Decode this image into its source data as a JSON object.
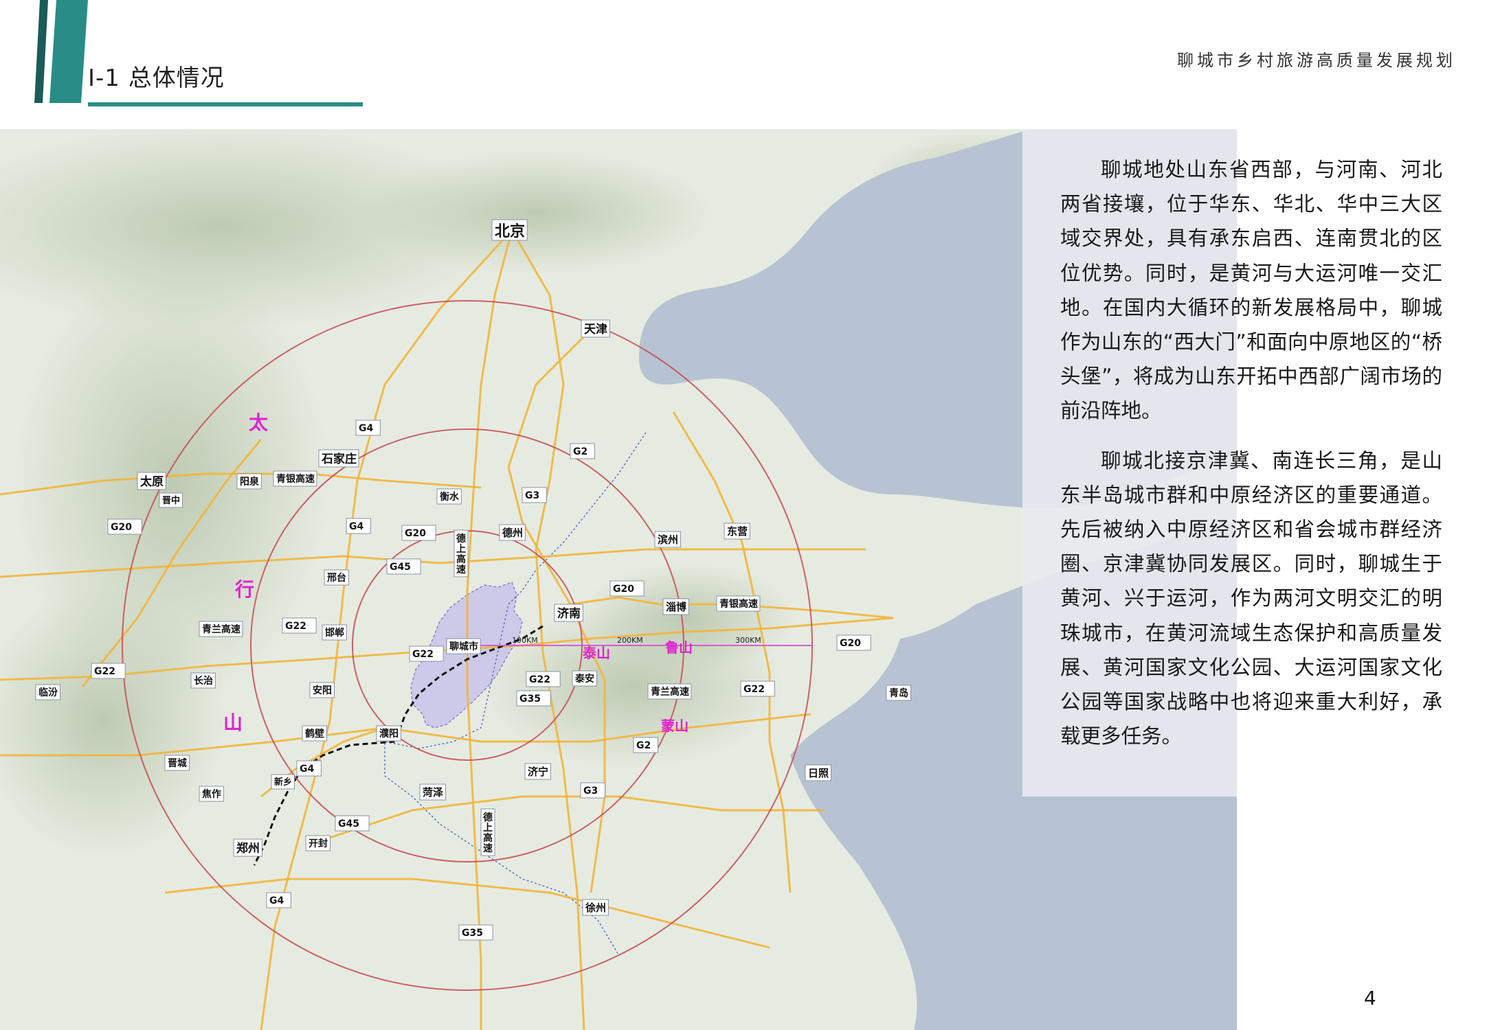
{
  "header": {
    "section_title": "Ⅰ-1 总体情况",
    "doc_title": "聊城市乡村旅游高质量发展规划"
  },
  "colors": {
    "accent_teal": "#2a8c86",
    "accent_dark": "#1b5c59",
    "ring": "#c7484e",
    "highway": "#f2b53a",
    "city_region": "#c8c3ea",
    "mountain_label": "#e024d0"
  },
  "map": {
    "cities": {
      "beijing": "北京",
      "tianjin": "天津",
      "shijiazhuang": "石家庄",
      "taiyuan": "太原",
      "yangquan": "阳泉",
      "jinzhong": "晋中",
      "hengshui": "衡水",
      "dezhou": "德州",
      "binzhou": "滨州",
      "dongying": "东营",
      "xingtai": "邢台",
      "jinan": "济南",
      "zibo": "淄博",
      "handan": "邯郸",
      "changzhi": "长治",
      "linfen": "临汾",
      "anyang": "安阳",
      "liaocheng": "聊城市",
      "taian": "泰安",
      "hebi": "鹤壁",
      "puyang": "濮阳",
      "jincheng": "晋城",
      "jiaozuo": "焦作",
      "xinxiang": "新乡",
      "jining": "济宁",
      "heze": "菏泽",
      "rizhao": "日照",
      "qingdao": "青岛",
      "zhengzhou": "郑州",
      "kaifeng": "开封",
      "xuzhou": "徐州"
    },
    "highways": {
      "g4": "G4",
      "g2": "G2",
      "g3": "G3",
      "g20": "G20",
      "g22": "G22",
      "g45": "G45",
      "g35": "G35",
      "qingyin": "青银高速",
      "qinglan": "青兰高速",
      "deshang_vertical": "德上高速"
    },
    "mountains": {
      "taihang": [
        "太",
        "行",
        "山"
      ],
      "taishan": "泰山",
      "lushan": "鲁山",
      "mengshan": "蒙山"
    },
    "distances": {
      "d100": "100KM",
      "d200": "200KM",
      "d300": "300KM"
    }
  },
  "body": {
    "paragraph_1": "聊城地处山东省西部，与河南、河北两省接壤，位于华东、华北、华中三大区域交界处，具有承东启西、连南贯北的区位优势。同时，是黄河与大运河唯一交汇地。在国内大循环的新发展格局中，聊城作为山东的“西大门”和面向中原地区的“桥头堡”，将成为山东开拓中西部广阔市场的前沿阵地。",
    "paragraph_2": "聊城北接京津冀、南连长三角，是山东半岛城市群和中原经济区的重要通道。先后被纳入中原经济区和省会城市群经济圈、京津冀协同发展区。同时，聊城生于黄河、兴于运河，作为两河文明交汇的明珠城市，在黄河流域生态保护和高质量发展、黄河国家文化公园、大运河国家文化公园等国家战略中也将迎来重大利好，承载更多任务。"
  },
  "footer": {
    "page_number": "4"
  }
}
